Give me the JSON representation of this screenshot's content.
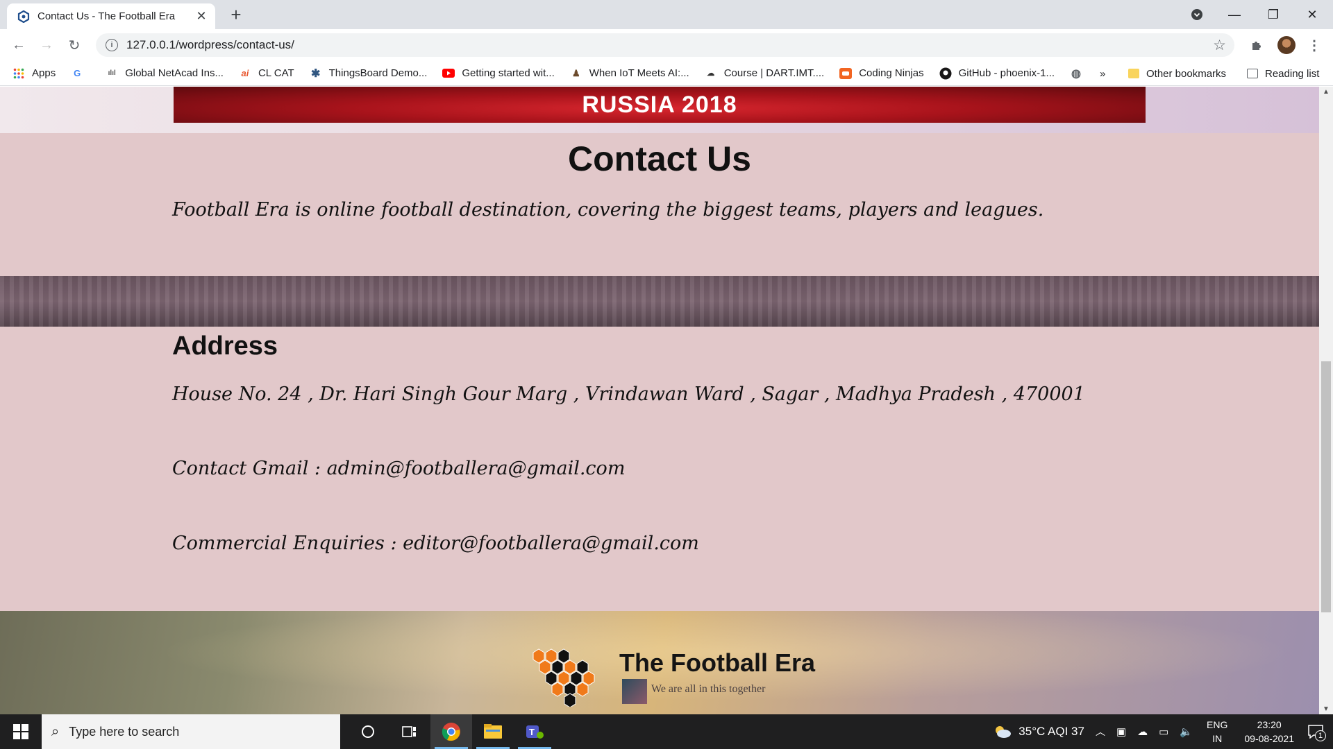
{
  "browser": {
    "tab_title": "Contact Us - The Football Era",
    "url": "127.0.0.1/wordpress/contact-us/",
    "bookmarks": [
      {
        "label": "Apps",
        "icon": "apps-grid-icon"
      },
      {
        "label": "",
        "icon": "google-icon"
      },
      {
        "label": "Global NetAcad Ins...",
        "icon": "cisco-icon"
      },
      {
        "label": "CL CAT",
        "icon": "ai-icon"
      },
      {
        "label": "ThingsBoard Demo...",
        "icon": "thingsboard-icon"
      },
      {
        "label": "Getting started wit...",
        "icon": "youtube-icon"
      },
      {
        "label": "When IoT Meets AI:...",
        "icon": "bookmark-icon"
      },
      {
        "label": "Course | DART.IMT....",
        "icon": "dart-icon"
      },
      {
        "label": "Coding Ninjas",
        "icon": "coding-ninjas-icon"
      },
      {
        "label": "GitHub - phoenix-1...",
        "icon": "github-icon"
      },
      {
        "label": "",
        "icon": "globe-icon"
      }
    ],
    "overflow_label": "»",
    "other_bookmarks": "Other bookmarks",
    "reading_list": "Reading list"
  },
  "page": {
    "banner_text": "RUSSIA 2018",
    "contact_title": "Contact Us",
    "intro": "Football Era is online football destination, covering the biggest teams, players and leagues.",
    "address_title": "Address",
    "address_line": "House No. 24 , Dr. Hari Singh Gour Marg , Vrindawan Ward , Sagar , Madhya Pradesh , 470001",
    "contact_gmail": "Contact Gmail : admin@footballera@gmail.com",
    "commercial": "Commercial Enquiries  : editor@footballera@gmail.com",
    "footer_brand": "The Football Era",
    "footer_tagline": "We are all in this together"
  },
  "taskbar": {
    "search_placeholder": "Type here to search",
    "weather": "35°C  AQI 37",
    "lang_top": "ENG",
    "lang_bottom": "IN",
    "time": "23:20",
    "date": "09-08-2021",
    "notification_count": "1"
  },
  "colors": {
    "page_bg": "#e2c8ca",
    "banner_red": "#b3141c",
    "taskbar": "#1f1f20"
  }
}
